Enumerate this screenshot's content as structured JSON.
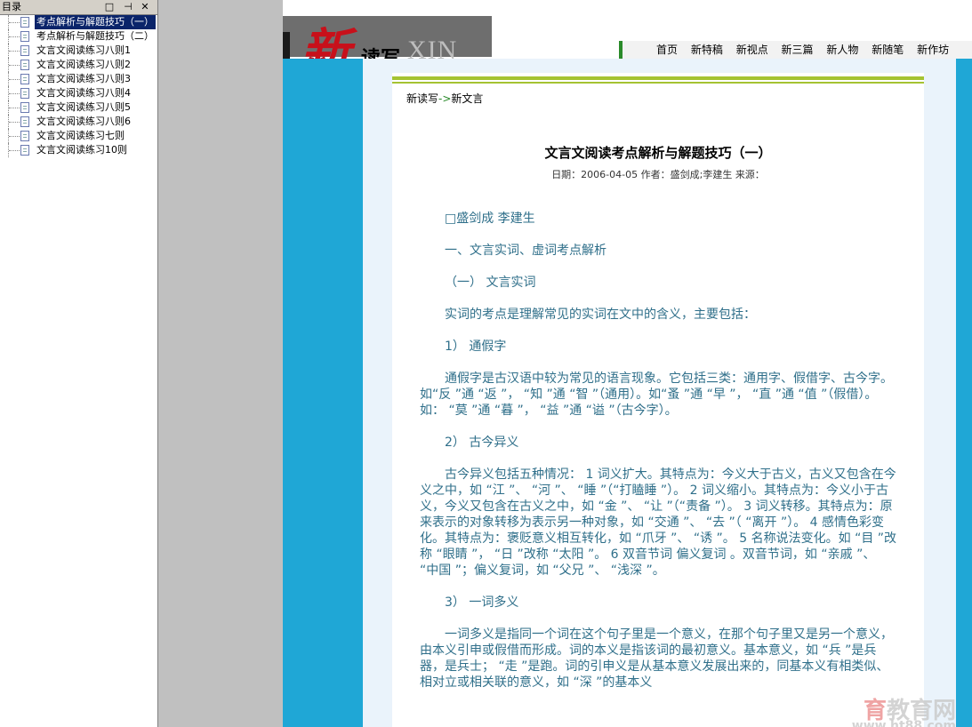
{
  "toc": {
    "title": "目录",
    "controls": [
      "□",
      "⊣",
      "✕"
    ],
    "items": [
      {
        "label": "考点解析与解题技巧（一）",
        "selected": true
      },
      {
        "label": "考点解析与解题技巧（二）",
        "selected": false
      },
      {
        "label": "文言文阅读练习八则1",
        "selected": false
      },
      {
        "label": "文言文阅读练习八则2",
        "selected": false
      },
      {
        "label": "文言文阅读练习八则3",
        "selected": false
      },
      {
        "label": "文言文阅读练习八则4",
        "selected": false
      },
      {
        "label": "文言文阅读练习八则5",
        "selected": false
      },
      {
        "label": "文言文阅读练习八则6",
        "selected": false
      },
      {
        "label": "文言文阅读练习七则",
        "selected": false
      },
      {
        "label": "文言文阅读练习10则",
        "selected": false
      }
    ]
  },
  "banner": {
    "logo_xin": "新",
    "logo_duxie": "读写",
    "logo_en": "XIN DU XIE",
    "nav": [
      "首页",
      "新特稿",
      "新视点",
      "新三篇",
      "新人物",
      "新随笔",
      "新作坊"
    ]
  },
  "article": {
    "breadcrumb_home": "新读写",
    "breadcrumb_arrow": "->",
    "breadcrumb_section": "新文言",
    "title": "文言文阅读考点解析与解题技巧（一）",
    "meta": "日期：2006-04-05  作者：盛剑成;李建生  来源：",
    "paragraphs": [
      "□盛剑成 李建生",
      "一、文言实词、虚词考点解析",
      "（一） 文言实词",
      "实词的考点是理解常见的实词在文中的含义，主要包括：",
      "1） 通假字",
      "通假字是古汉语中较为常见的语言现象。它包括三类：通用字、假借字、古今字。如“反 ”通 “返 ”， “知 ”通 “智 ”（通用）。如“蚤 ”通 “早 ”， “直 ”通 “值 ”（假借）。如： “莫 ”通 “暮 ”， “益 ”通 “谥 ”（古今字）。",
      "2） 古今异义",
      "古今异义包括五种情况： 1 词义扩大。其特点为：今义大于古义，古义又包含在今义之中，如 “江 ”、 “河 ”、 “睡 ”（“打瞌睡 ”）。 2 词义缩小。其特点为：今义小于古义，今义又包含在古义之中，如 “金 ”、 “让 ”（“责备 ”）。 3 词义转移。其特点为：原来表示的对象转移为表示另一种对象，如 “交通 ”、 “去 ”（ “离开 ”）。 4 感情色彩变化。其特点为：褒贬意义相互转化，如 “爪牙 ”、 “诱 ”。 5 名称说法变化。如 “目 ”改称 “眼睛 ”， “日 ”改称 “太阳 ”。 6 双音节词 偏义复词 。双音节词，如 “亲戚 ”、 “中国 ”；偏义复词，如 “父兄 ”、 “浅深 ”。",
      "3） 一词多义",
      "一词多义是指同一个词在这个句子里是一个意义，在那个句子里又是另一个意义，由本义引申或假借而形成。词的本义是指该词的最初意义。基本意义，如 “兵 ”是兵器，是兵士； “走 ”是跑。词的引申义是从基本意义发展出来的，同基本义有相类似、相对立或相关联的意义，如 “深 ”的基本义"
    ]
  },
  "watermark": {
    "brand": "育",
    "name": "教育网",
    "url": "www.ht88.com"
  }
}
